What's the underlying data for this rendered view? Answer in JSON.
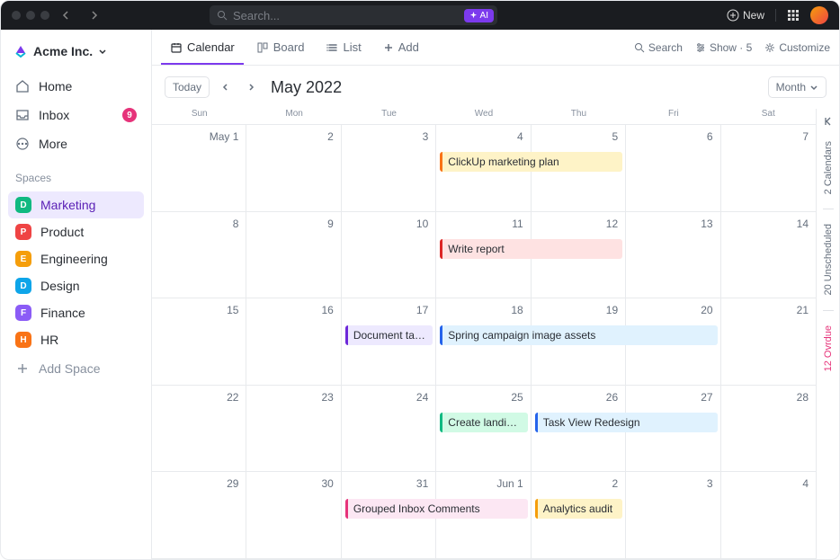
{
  "titlebar": {
    "search_placeholder": "Search...",
    "ai_label": "AI",
    "new_label": "New"
  },
  "workspace": {
    "name": "Acme Inc."
  },
  "nav": {
    "home": "Home",
    "inbox": "Inbox",
    "inbox_count": "9",
    "more": "More"
  },
  "spaces_label": "Spaces",
  "spaces": [
    {
      "letter": "D",
      "label": "Marketing",
      "color": "#10b981",
      "active": true
    },
    {
      "letter": "P",
      "label": "Product",
      "color": "#ef4444"
    },
    {
      "letter": "E",
      "label": "Engineering",
      "color": "#f59e0b"
    },
    {
      "letter": "D",
      "label": "Design",
      "color": "#0ea5e9"
    },
    {
      "letter": "F",
      "label": "Finance",
      "color": "#8b5cf6"
    },
    {
      "letter": "H",
      "label": "HR",
      "color": "#f97316"
    }
  ],
  "add_space": "Add Space",
  "tabs": {
    "calendar": "Calendar",
    "board": "Board",
    "list": "List",
    "add": "Add",
    "search": "Search",
    "show": "Show · 5",
    "customize": "Customize"
  },
  "toolbar": {
    "today": "Today",
    "title": "May 2022",
    "mode": "Month"
  },
  "dow": [
    "Sun",
    "Mon",
    "Tue",
    "Wed",
    "Thu",
    "Fri",
    "Sat"
  ],
  "weeks": [
    {
      "days": [
        "May 1",
        "2",
        "3",
        "4",
        "5",
        "6",
        "7"
      ],
      "events": [
        {
          "label": "ClickUp marketing plan",
          "start": 4,
          "span": 2,
          "bg": "#fef3c7",
          "bar": "#f97316"
        }
      ]
    },
    {
      "days": [
        "8",
        "9",
        "10",
        "11",
        "12",
        "13",
        "14"
      ],
      "events": [
        {
          "label": "Write report",
          "start": 4,
          "span": 2,
          "bg": "#fee2e2",
          "bar": "#dc2626"
        }
      ]
    },
    {
      "days": [
        "15",
        "16",
        "17",
        "18",
        "19",
        "20",
        "21"
      ],
      "events": [
        {
          "label": "Document target users",
          "start": 3,
          "span": 1,
          "bg": "#ede9fe",
          "bar": "#6d28d9"
        },
        {
          "label": "Spring campaign image assets",
          "start": 4,
          "span": 3,
          "bg": "#e0f2fe",
          "bar": "#2563eb"
        }
      ]
    },
    {
      "days": [
        "22",
        "23",
        "24",
        "25",
        "26",
        "27",
        "28"
      ],
      "events": [
        {
          "label": "Create landing page",
          "start": 4,
          "span": 1,
          "bg": "#d1fae5",
          "bar": "#10b981"
        },
        {
          "label": "Task View Redesign",
          "start": 5,
          "span": 2,
          "bg": "#e0f2fe",
          "bar": "#2563eb"
        }
      ]
    },
    {
      "days": [
        "29",
        "30",
        "31",
        "Jun 1",
        "2",
        "3",
        "4"
      ],
      "events": [
        {
          "label": "Grouped Inbox Comments",
          "start": 3,
          "span": 2,
          "bg": "#fce7f3",
          "bar": "#e6337a"
        },
        {
          "label": "Analytics audit",
          "start": 5,
          "span": 1,
          "bg": "#fef3c7",
          "bar": "#f59e0b"
        }
      ]
    }
  ],
  "rail": {
    "calendars": "2 Calendars",
    "unscheduled": "20 Unscheduled",
    "overdue": "12 Ovrdue"
  }
}
